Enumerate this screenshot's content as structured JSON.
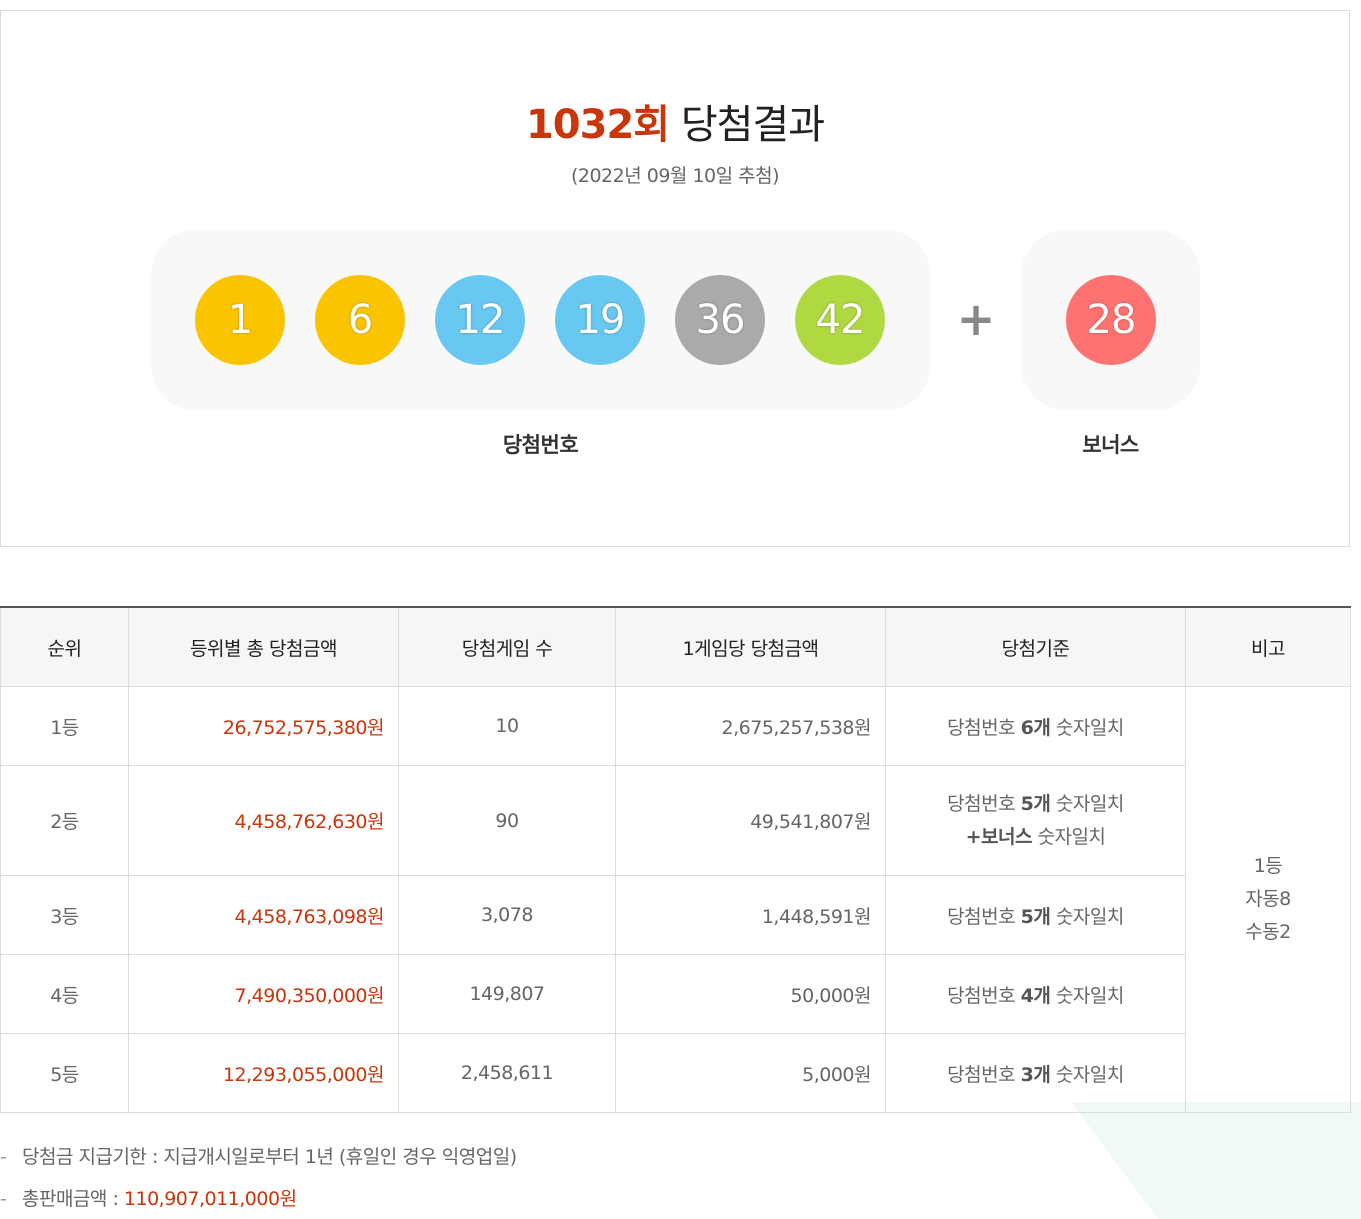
{
  "header": {
    "round": "1032회",
    "title_suffix": "당첨결과",
    "draw_date": "(2022년 09월 10일 추첨)"
  },
  "balls": {
    "numbers": [
      {
        "value": "1",
        "color": "#fbc400"
      },
      {
        "value": "6",
        "color": "#fbc400"
      },
      {
        "value": "12",
        "color": "#69c8f2"
      },
      {
        "value": "19",
        "color": "#69c8f2"
      },
      {
        "value": "36",
        "color": "#aaaaaa"
      },
      {
        "value": "42",
        "color": "#b0d840"
      }
    ],
    "plus": "+",
    "bonus": {
      "value": "28",
      "color": "#ff7272"
    },
    "win_label": "당첨번호",
    "bonus_label": "보너스"
  },
  "table": {
    "headers": [
      "순위",
      "등위별 총 당첨금액",
      "당첨게임 수",
      "1게임당 당첨금액",
      "당첨기준",
      "비고"
    ],
    "rows": [
      {
        "rank": "1등",
        "total": "26,752,575,380원",
        "games": "10",
        "per_game": "2,675,257,538원",
        "crit_a": "당첨번호 ",
        "crit_b": "6개",
        "crit_c": " 숫자일치"
      },
      {
        "rank": "2등",
        "total": "4,458,762,630원",
        "games": "90",
        "per_game": "49,541,807원",
        "crit_a": "당첨번호 ",
        "crit_b": "5개",
        "crit_c": " 숫자일치",
        "crit2_b": "+보너스",
        "crit2_c": " 숫자일치"
      },
      {
        "rank": "3등",
        "total": "4,458,763,098원",
        "games": "3,078",
        "per_game": "1,448,591원",
        "crit_a": "당첨번호 ",
        "crit_b": "5개",
        "crit_c": " 숫자일치"
      },
      {
        "rank": "4등",
        "total": "7,490,350,000원",
        "games": "149,807",
        "per_game": "50,000원",
        "crit_a": "당첨번호 ",
        "crit_b": "4개",
        "crit_c": " 숫자일치"
      },
      {
        "rank": "5등",
        "total": "12,293,055,000원",
        "games": "2,458,611",
        "per_game": "5,000원",
        "crit_a": "당첨번호 ",
        "crit_b": "3개",
        "crit_c": " 숫자일치"
      }
    ],
    "note": [
      "1등",
      "자동8",
      "수동2"
    ]
  },
  "footer": {
    "dash": "-",
    "deadline_label": "당첨금 지급기한 : ",
    "deadline_value": "지급개시일로부터 1년 (휴일인 경우 익영업일)",
    "sales_label": "총판매금액 : ",
    "sales_value": "110,907,011,000원"
  }
}
